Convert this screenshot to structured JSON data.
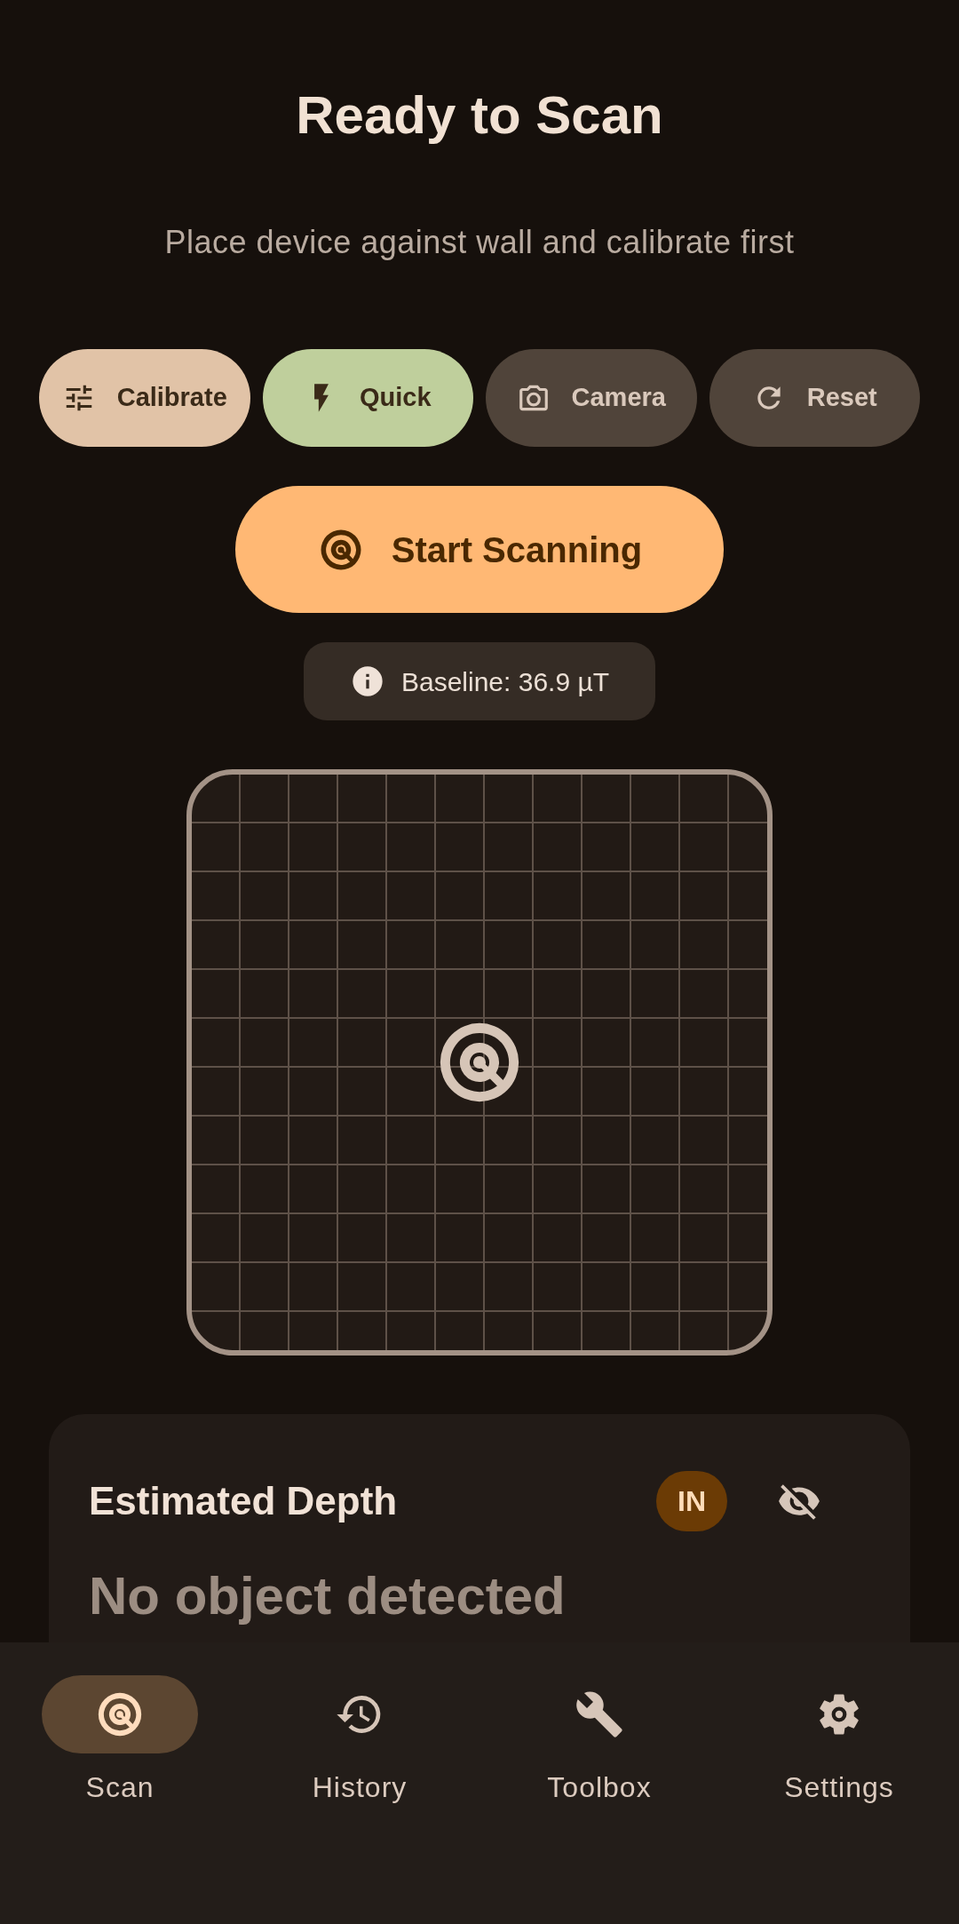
{
  "header": {
    "title": "Ready to Scan",
    "subtitle": "Place device against wall and calibrate first"
  },
  "actions": [
    {
      "label": "Calibrate",
      "color": "#e1c3a7"
    },
    {
      "label": "Quick",
      "color": "#bfcf9c"
    },
    {
      "label": "Camera",
      "color": "#50443a"
    },
    {
      "label": "Reset",
      "color": "#50443a"
    }
  ],
  "start_button": {
    "label": "Start Scanning"
  },
  "baseline": {
    "text": "Baseline: 36.9 µT"
  },
  "depth_card": {
    "title": "Estimated Depth",
    "unit_badge": "IN",
    "visible": false,
    "status": "No object detected"
  },
  "nav": [
    {
      "label": "Scan",
      "selected": true
    },
    {
      "label": "History",
      "selected": false
    },
    {
      "label": "Toolbox",
      "selected": false
    },
    {
      "label": "Settings",
      "selected": false
    }
  ]
}
